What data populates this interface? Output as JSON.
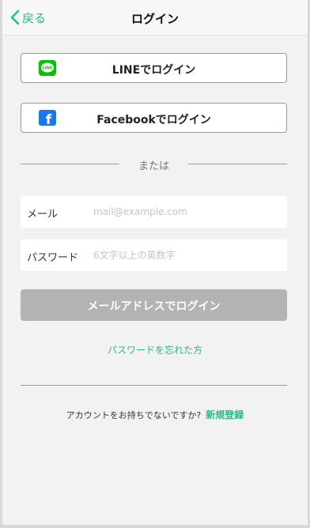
{
  "nav": {
    "back_label": "戻る",
    "title": "ログイン"
  },
  "social": {
    "line_label": "LINEでログイン",
    "line_icon_text": "LINE",
    "facebook_label": "Facebookでログイン",
    "facebook_icon_text": "f"
  },
  "divider": {
    "or_text": "または"
  },
  "form": {
    "email_label": "メール",
    "email_placeholder": "mail@example.com",
    "password_label": "パスワード",
    "password_placeholder": "6文字以上の英数字"
  },
  "actions": {
    "mail_login_label": "メールアドレスでログイン",
    "forgot_label": "パスワードを忘れた方",
    "signup_prompt": "アカウントをお持ちでないですか?",
    "signup_link": "新規登録"
  },
  "colors": {
    "accent": "#20c07f",
    "line_green": "#00c300",
    "facebook_blue": "#1877f2",
    "disabled_button": "#b3b3b3"
  }
}
